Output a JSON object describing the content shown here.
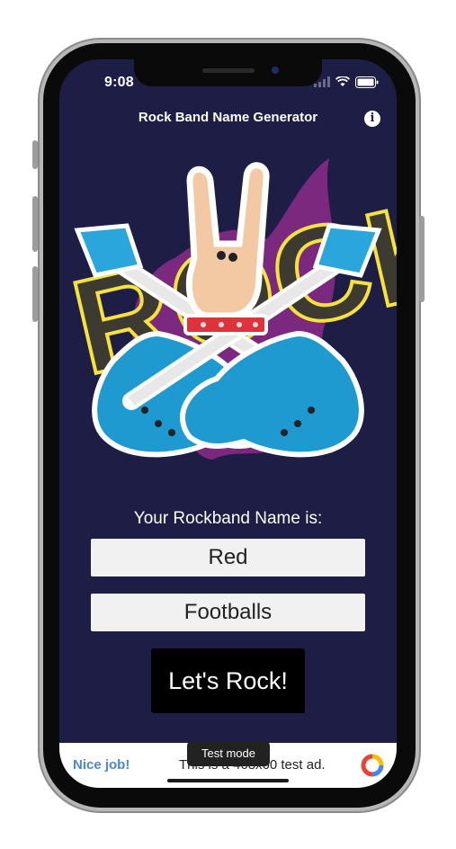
{
  "status_bar": {
    "time": "9:08"
  },
  "app_bar": {
    "title": "Rock Band Name Generator",
    "info_icon": "info-icon"
  },
  "hero": {
    "word": "ROCK"
  },
  "generator": {
    "label": "Your Rockband Name is:",
    "first_word": "Red",
    "second_word": "Footballs",
    "button_label": "Let's Rock!"
  },
  "ad": {
    "nice_job": "Nice job!",
    "text": "This is a 468x60 test ad.",
    "tooltip": "Test mode"
  },
  "colors": {
    "background": "#1e1d45",
    "button": "#000000",
    "name_box": "#f1f1f1",
    "guitar": "#1e9ad1",
    "ad_link": "#4a86e0"
  }
}
